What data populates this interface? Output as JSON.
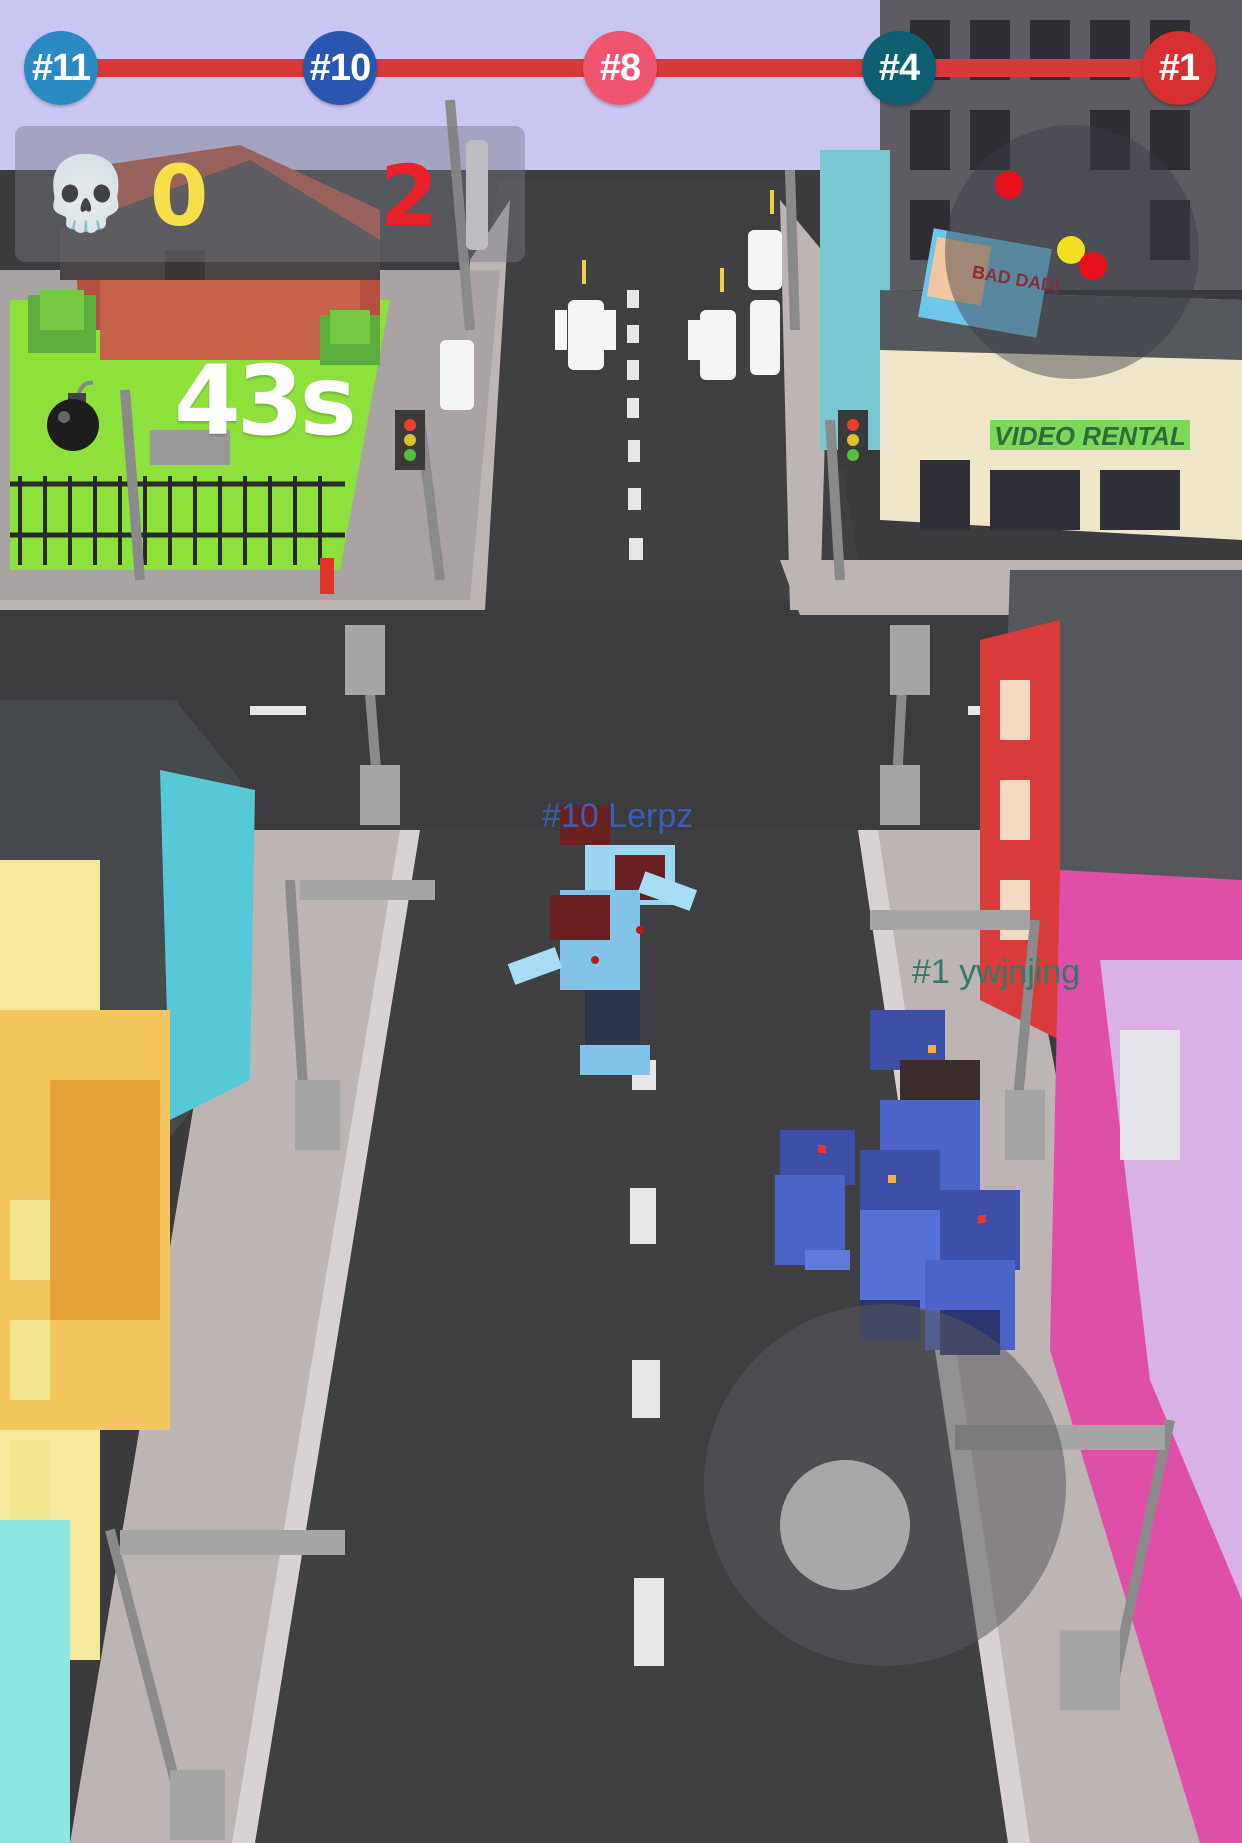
{
  "rank_bar": {
    "badges": [
      {
        "label": "#11",
        "color": "#2a8ac4"
      },
      {
        "label": "#10",
        "color": "#2956b0"
      },
      {
        "label": "#8",
        "color": "#f0556f"
      },
      {
        "label": "#4",
        "color": "#0f5f72"
      },
      {
        "label": "#1",
        "color": "#d63030"
      }
    ]
  },
  "score": {
    "kills_icon": "skull-icon",
    "kills": "0",
    "kills_color": "#f5e04a",
    "count": "2",
    "count_color": "#e8212a"
  },
  "timer": {
    "icon": "bomb-icon",
    "value": "43s"
  },
  "minimap": {
    "dots": [
      {
        "color": "#e8101a"
      },
      {
        "color": "#f0e020"
      },
      {
        "color": "#e8101a"
      }
    ]
  },
  "world": {
    "billboard_text": "BAD DAD!",
    "store_sign": "VIDEO RENTAL"
  },
  "players": [
    {
      "label": "#10 Lerpz",
      "color": "#3b5fb8"
    },
    {
      "label": "#1 ywjnjing",
      "color": "#2f7a68"
    }
  ],
  "joystick": {
    "name": "virtual-joystick"
  }
}
